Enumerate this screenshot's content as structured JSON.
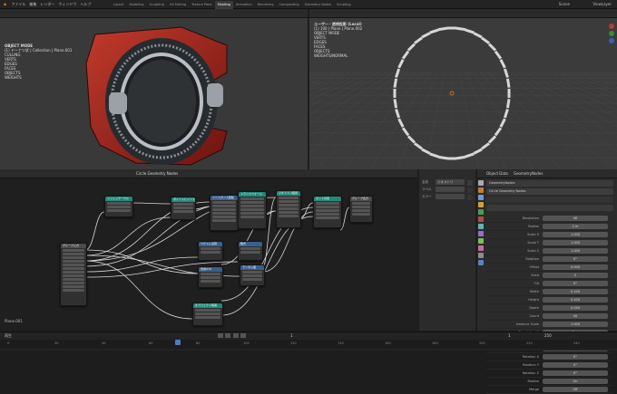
{
  "app": {
    "menu": [
      "ファイル",
      "編集",
      "レンダー",
      "ウィンドウ",
      "ヘルプ"
    ],
    "workspaces": [
      "Layout",
      "Modeling",
      "Sculpting",
      "UV Editing",
      "Texture Paint",
      "Shading",
      "Animation",
      "Rendering",
      "Compositing",
      "Geometry Nodes",
      "Scripting"
    ],
    "active_workspace_index": 5,
    "scene_label": "Scene",
    "view_layer_label": "ViewLayer"
  },
  "viewport_left": {
    "overlay": [
      "OBJECT MODE",
      "(1) ドーナツ状 | Collection | Plane.001",
      "CULLING",
      "VERTS",
      "EDGES",
      "FACES",
      "OBJECTS",
      "WEIGHTS"
    ],
    "colors": {
      "body": "#a3231d",
      "ring": "#4b5560",
      "bg": "#3a3a3a"
    }
  },
  "viewport_right": {
    "overlay": [
      "ユーザー・透視投影 (Local)",
      "(1) 100 | Plane | Plane.002",
      "OBJECT MODE",
      "VERTS",
      "EDGES",
      "FACES",
      "OBJECTS",
      "WEIGHTS/NORMAL"
    ],
    "segment_count": 40
  },
  "node_editor": {
    "header_label": "Circle Geometry Nodes",
    "status": "Plane.001",
    "nodes": [
      {
        "id": "n1",
        "title": "グループ入力",
        "color": "gray"
      },
      {
        "id": "n2",
        "title": "メッシュサークル",
        "color": "teal"
      },
      {
        "id": "n3",
        "title": "ポイントにインスタンス",
        "color": "teal"
      },
      {
        "id": "n4",
        "title": "インスタンス回転",
        "color": "blue"
      },
      {
        "id": "n5",
        "title": "トランスフォーム",
        "color": "teal"
      },
      {
        "id": "n6",
        "title": "ジオメトリ結合",
        "color": "teal"
      },
      {
        "id": "n7",
        "title": "セット位置",
        "color": "teal"
      },
      {
        "id": "n8",
        "title": "グループ出力",
        "color": "gray"
      },
      {
        "id": "n9",
        "title": "ベクトル演算",
        "color": "blue"
      },
      {
        "id": "n10",
        "title": "数式",
        "color": "blue"
      },
      {
        "id": "n11",
        "title": "合成XYZ",
        "color": "blue"
      },
      {
        "id": "n12",
        "title": "ランダム値",
        "color": "blue"
      },
      {
        "id": "n13",
        "title": "オブジェクト情報",
        "color": "teal"
      }
    ]
  },
  "sidebar": {
    "tabs": [
      "ノード",
      "ツール",
      "ビュー"
    ],
    "fields": [
      {
        "label": "名前",
        "value": "ジオメトリ"
      },
      {
        "label": "ラベル",
        "value": ""
      },
      {
        "label": "カラー",
        "value": ""
      }
    ]
  },
  "properties": {
    "header_tabs": [
      "Object Data",
      "GeometryNodes"
    ],
    "modifier_name": "GeometryNodes",
    "node_group": "Circle Geometry Nodes",
    "rows": [
      {
        "label": "Resolution",
        "value": "40"
      },
      {
        "label": "Radius",
        "value": "2 m"
      },
      {
        "label": "Scale X",
        "value": "1.000"
      },
      {
        "label": "Scale Y",
        "value": "1.000"
      },
      {
        "label": "Scale Z",
        "value": "1.000"
      },
      {
        "label": "Rotation",
        "value": "0°"
      },
      {
        "label": "Offset",
        "value": "0.000"
      },
      {
        "label": "Seed",
        "value": "0"
      },
      {
        "label": "Tilt",
        "value": "0°"
      },
      {
        "label": "Width",
        "value": "0.100"
      },
      {
        "label": "Height",
        "value": "0.200"
      },
      {
        "label": "Depth",
        "value": "0.050"
      },
      {
        "label": "Count",
        "value": "40"
      },
      {
        "label": "Instance Scale",
        "value": "1.000"
      },
      {
        "label": "Translation X",
        "value": "0 m"
      },
      {
        "label": "Translation Y",
        "value": "0 m"
      },
      {
        "label": "Translation Z",
        "value": "0 m"
      },
      {
        "label": "Rotation X",
        "value": "0°"
      },
      {
        "label": "Rotation Y",
        "value": "0°"
      },
      {
        "label": "Rotation Z",
        "value": "0°"
      },
      {
        "label": "Realize",
        "value": "On"
      },
      {
        "label": "Merge",
        "value": "Off"
      }
    ]
  },
  "timeline": {
    "current_frame": "1",
    "start": "1",
    "end": "250",
    "ticks": [
      "0",
      "20",
      "40",
      "60",
      "80",
      "100",
      "120",
      "140",
      "160",
      "180",
      "200",
      "220",
      "240"
    ],
    "playback_label": "再生"
  }
}
